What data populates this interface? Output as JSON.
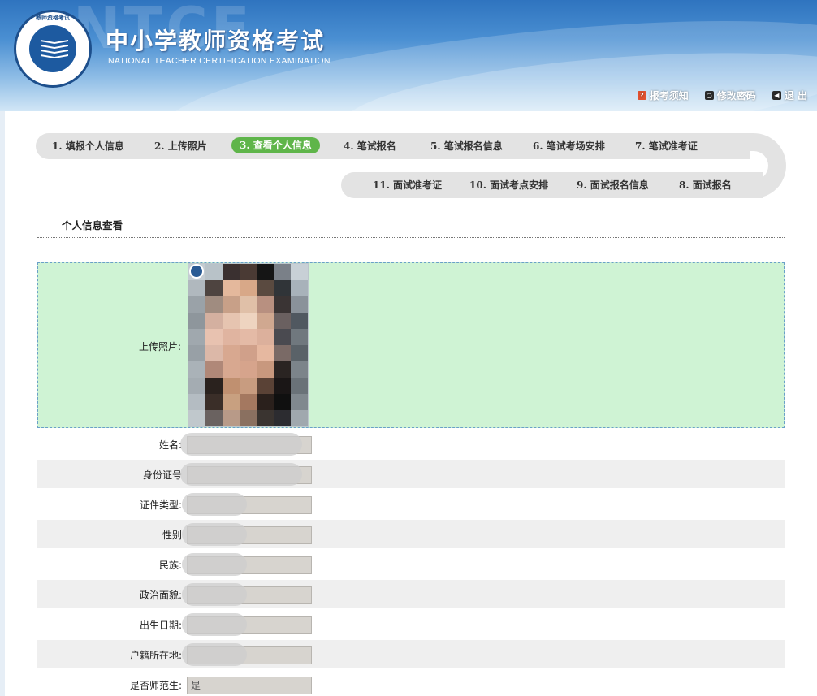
{
  "header": {
    "logo_ring_text": "教师资格考试",
    "watermark": "NTCE",
    "title": "中小学教师资格考试",
    "subtitle": "NATIONAL TEACHER CERTIFICATION EXAMINATION",
    "links": [
      {
        "label": "报考须知",
        "icon": "help-icon"
      },
      {
        "label": "修改密码",
        "icon": "key-icon"
      },
      {
        "label": "退 出",
        "icon": "exit-icon"
      }
    ]
  },
  "steps": [
    {
      "label": "1. 填报个人信息",
      "active": false
    },
    {
      "label": "2. 上传照片",
      "active": false
    },
    {
      "label": "3. 查看个人信息",
      "active": true
    },
    {
      "label": "4. 笔试报名",
      "active": false
    },
    {
      "label": "5. 笔试报名信息",
      "active": false
    },
    {
      "label": "6. 笔试考场安排",
      "active": false
    },
    {
      "label": "7. 笔试准考证",
      "active": false
    },
    {
      "label": "8. 面试报名",
      "active": false
    },
    {
      "label": "9. 面试报名信息",
      "active": false
    },
    {
      "label": "10. 面试考点安排",
      "active": false
    },
    {
      "label": "11. 面试准考证",
      "active": false
    }
  ],
  "section": {
    "title": "个人信息查看"
  },
  "form": {
    "photo_label": "上传照片:",
    "fields": [
      {
        "label": "姓名:",
        "value": ""
      },
      {
        "label": "身份证号",
        "value": ""
      },
      {
        "label": "证件类型:",
        "value": ""
      },
      {
        "label": "性别",
        "value": ""
      },
      {
        "label": "民族:",
        "value": ""
      },
      {
        "label": "政治面貌:",
        "value": ""
      },
      {
        "label": "出生日期:",
        "value": ""
      },
      {
        "label": "户籍所在地:",
        "value": ""
      },
      {
        "label": "是否师范生:",
        "value": "是"
      }
    ]
  },
  "colors": {
    "active_step": "#5fb54a",
    "photo_row_bg": "#cff3d4",
    "header_blue": "#2f74bf"
  }
}
